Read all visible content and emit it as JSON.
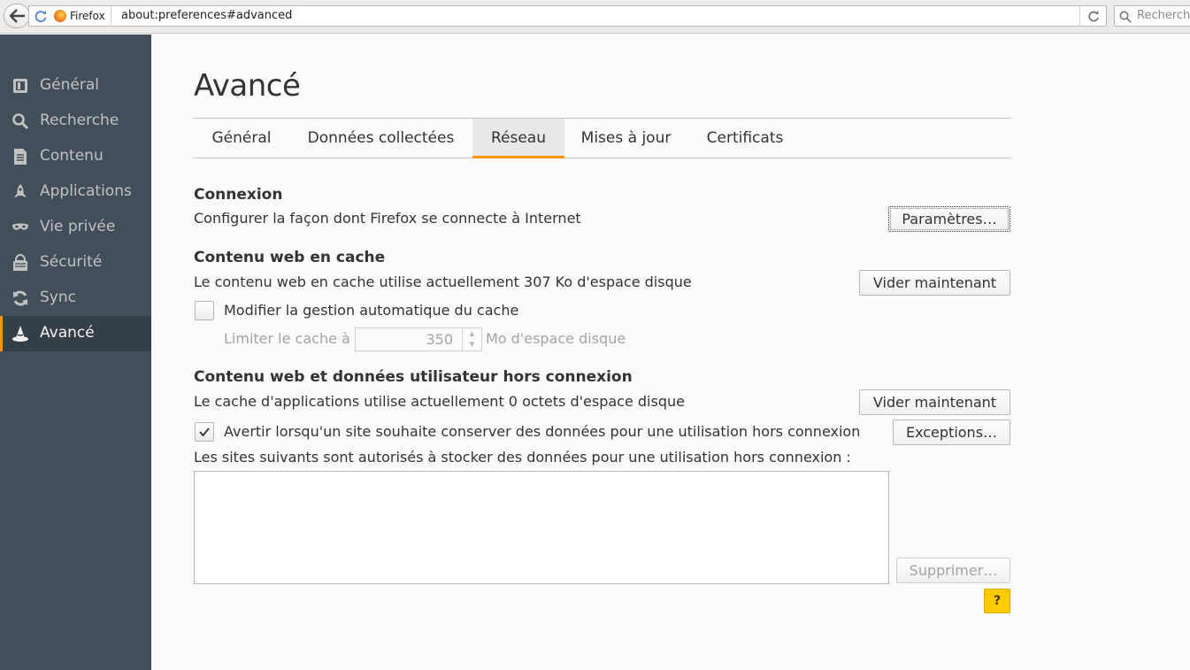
{
  "browser": {
    "identity_label": "Firefox",
    "url": "about:preferences#advanced",
    "search_placeholder": "Recherche"
  },
  "sidebar": {
    "items": [
      {
        "label": "Général",
        "icon": "general-icon"
      },
      {
        "label": "Recherche",
        "icon": "search-icon"
      },
      {
        "label": "Contenu",
        "icon": "content-icon"
      },
      {
        "label": "Applications",
        "icon": "applications-icon"
      },
      {
        "label": "Vie privée",
        "icon": "privacy-mask-icon"
      },
      {
        "label": "Sécurité",
        "icon": "security-icon"
      },
      {
        "label": "Sync",
        "icon": "sync-icon"
      },
      {
        "label": "Avancé",
        "icon": "advanced-wizard-hat-icon",
        "selected": true
      }
    ]
  },
  "main": {
    "title": "Avancé",
    "tabs": [
      {
        "label": "Général"
      },
      {
        "label": "Données collectées"
      },
      {
        "label": "Réseau",
        "selected": true
      },
      {
        "label": "Mises à jour"
      },
      {
        "label": "Certificats"
      }
    ],
    "connection": {
      "heading": "Connexion",
      "description": "Configurer la façon dont Firefox se connecte à Internet",
      "settings_button": "Paramètres…"
    },
    "cache": {
      "heading": "Contenu web en cache",
      "description": "Le contenu web en cache utilise actuellement 307 Ko d'espace disque",
      "clear_button": "Vider maintenant",
      "override_checkbox_label": "Modifier la gestion automatique du cache",
      "override_checked": false,
      "limit_label": "Limiter le cache à",
      "limit_value": "350",
      "limit_unit": "Mo d'espace disque"
    },
    "offline": {
      "heading": "Contenu web et données utilisateur hors connexion",
      "description": "Le cache d'applications utilise actuellement 0 octets d'espace disque",
      "clear_button": "Vider maintenant",
      "warn_checkbox_label": "Avertir lorsqu'un site souhaite conserver des données pour une utilisation hors connexion",
      "warn_checked": true,
      "exceptions_button": "Exceptions…",
      "sites_label": "Les sites suivants sont autorisés à stocker des données pour une utilisation hors connexion :",
      "sites": [],
      "remove_button": "Supprimer…"
    },
    "help_button": "?"
  },
  "colors": {
    "sidebar_bg": "#424f5a",
    "sidebar_selected_bg": "#343f48",
    "accent": "#ff9500",
    "help_yellow": "#ffcb00"
  }
}
